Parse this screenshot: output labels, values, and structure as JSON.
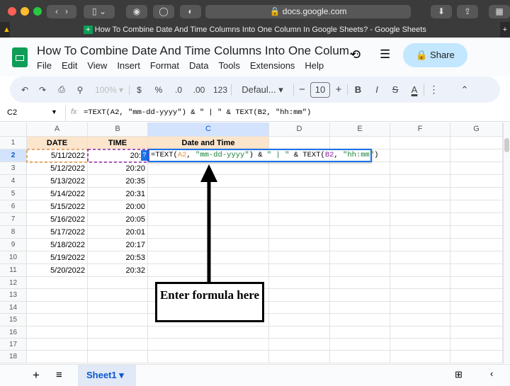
{
  "browser": {
    "url": "docs.google.com",
    "tab_title": "How To Combine Date And Time Columns Into One Column In Google Sheets? - Google Sheets"
  },
  "doc": {
    "title": "How To Combine Date And Time Columns Into One Colum...",
    "menu": [
      "File",
      "Edit",
      "View",
      "Insert",
      "Format",
      "Data",
      "Tools",
      "Extensions",
      "Help"
    ],
    "share_label": "Share"
  },
  "toolbar": {
    "zoom": "100%",
    "currency": "$",
    "percent": "%",
    "dec_less": ".0",
    "dec_more": ".00",
    "number_format": "123",
    "font": "Defaul...",
    "font_size": "10",
    "bold": "B",
    "italic": "I",
    "text_color": "A"
  },
  "formula_bar": {
    "cell_ref": "C2",
    "fx": "fx",
    "formula": "=TEXT(A2, \"mm-dd-yyyy\") & \" | \" & TEXT(B2, \"hh:mm\")"
  },
  "columns": [
    "A",
    "B",
    "C",
    "D",
    "E",
    "F",
    "G"
  ],
  "rows": [
    {
      "n": "1",
      "a": "DATE",
      "b": "TIME",
      "c": "Date and Time"
    },
    {
      "n": "2",
      "a": "5/11/2022",
      "b": "20:2",
      "c": ""
    },
    {
      "n": "3",
      "a": "5/12/2022",
      "b": "20:20",
      "c": ""
    },
    {
      "n": "4",
      "a": "5/13/2022",
      "b": "20:35",
      "c": ""
    },
    {
      "n": "5",
      "a": "5/14/2022",
      "b": "20:31",
      "c": ""
    },
    {
      "n": "6",
      "a": "5/15/2022",
      "b": "20:00",
      "c": ""
    },
    {
      "n": "7",
      "a": "5/16/2022",
      "b": "20:05",
      "c": ""
    },
    {
      "n": "8",
      "a": "5/17/2022",
      "b": "20:01",
      "c": ""
    },
    {
      "n": "9",
      "a": "5/18/2022",
      "b": "20:17",
      "c": ""
    },
    {
      "n": "10",
      "a": "5/19/2022",
      "b": "20:53",
      "c": ""
    },
    {
      "n": "11",
      "a": "5/20/2022",
      "b": "20:32",
      "c": ""
    },
    {
      "n": "12"
    },
    {
      "n": "13"
    },
    {
      "n": "14"
    },
    {
      "n": "15"
    },
    {
      "n": "16"
    },
    {
      "n": "17"
    },
    {
      "n": "18"
    }
  ],
  "cell_editor": {
    "help": "?",
    "parts": [
      "=TEXT(",
      "A2",
      ", ",
      "\"mm-dd-yyyy\"",
      ") & ",
      "\" | \"",
      " & TEXT(",
      "B2",
      ", ",
      "\"hh:mm\"",
      ")"
    ]
  },
  "annotation": {
    "text": "Enter formula here"
  },
  "sheets": {
    "active": "Sheet1"
  }
}
